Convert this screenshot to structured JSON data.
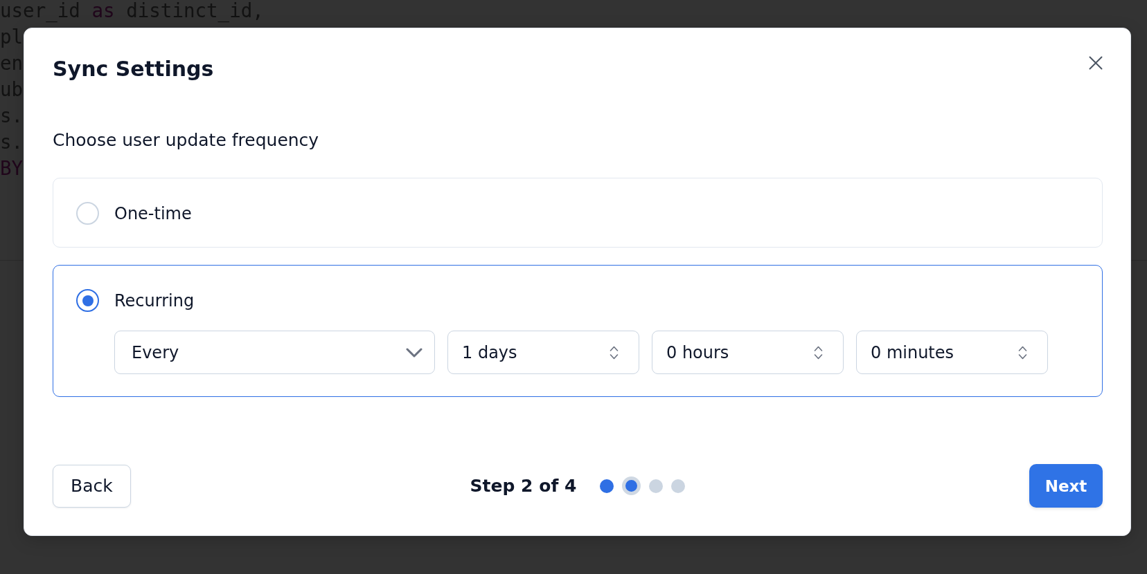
{
  "background_code": {
    "lines": [
      {
        "tokens": [
          {
            "text": "user_id",
            "kind": "plain"
          },
          {
            "text": "as",
            "kind": "keyword"
          },
          {
            "text": "distinct_id,",
            "kind": "plain"
          }
        ]
      },
      {
        "tokens": [
          {
            "text": "pl",
            "kind": "plain"
          }
        ]
      },
      {
        "tokens": [
          {
            "text": "en",
            "kind": "plain"
          }
        ]
      },
      {
        "tokens": [
          {
            "text": "ub",
            "kind": "plain"
          }
        ]
      },
      {
        "tokens": [
          {
            "text": "s.",
            "kind": "plain"
          }
        ]
      },
      {
        "tokens": [
          {
            "text": "s.",
            "kind": "plain"
          }
        ]
      },
      {
        "tokens": [
          {
            "text": "BY",
            "kind": "keyword"
          }
        ]
      }
    ]
  },
  "dialog": {
    "title": "Sync Settings",
    "prompt": "Choose user update frequency",
    "options": [
      {
        "label": "One-time",
        "selected": false
      },
      {
        "label": "Recurring",
        "selected": true,
        "schedule": [
          {
            "kind": "dropdown",
            "value": "Every"
          },
          {
            "kind": "spinner",
            "value": "1 days"
          },
          {
            "kind": "spinner",
            "value": "0 hours"
          },
          {
            "kind": "spinner",
            "value": "0 minutes"
          }
        ]
      }
    ],
    "footer": {
      "back_button": "Back",
      "step_label": "Step 2 of 4",
      "steps": [
        {
          "completed": true,
          "selected": false
        },
        {
          "completed": false,
          "selected": true
        },
        {
          "completed": false,
          "selected": false
        },
        {
          "completed": false,
          "selected": false
        }
      ],
      "next_button": "Next"
    }
  }
}
